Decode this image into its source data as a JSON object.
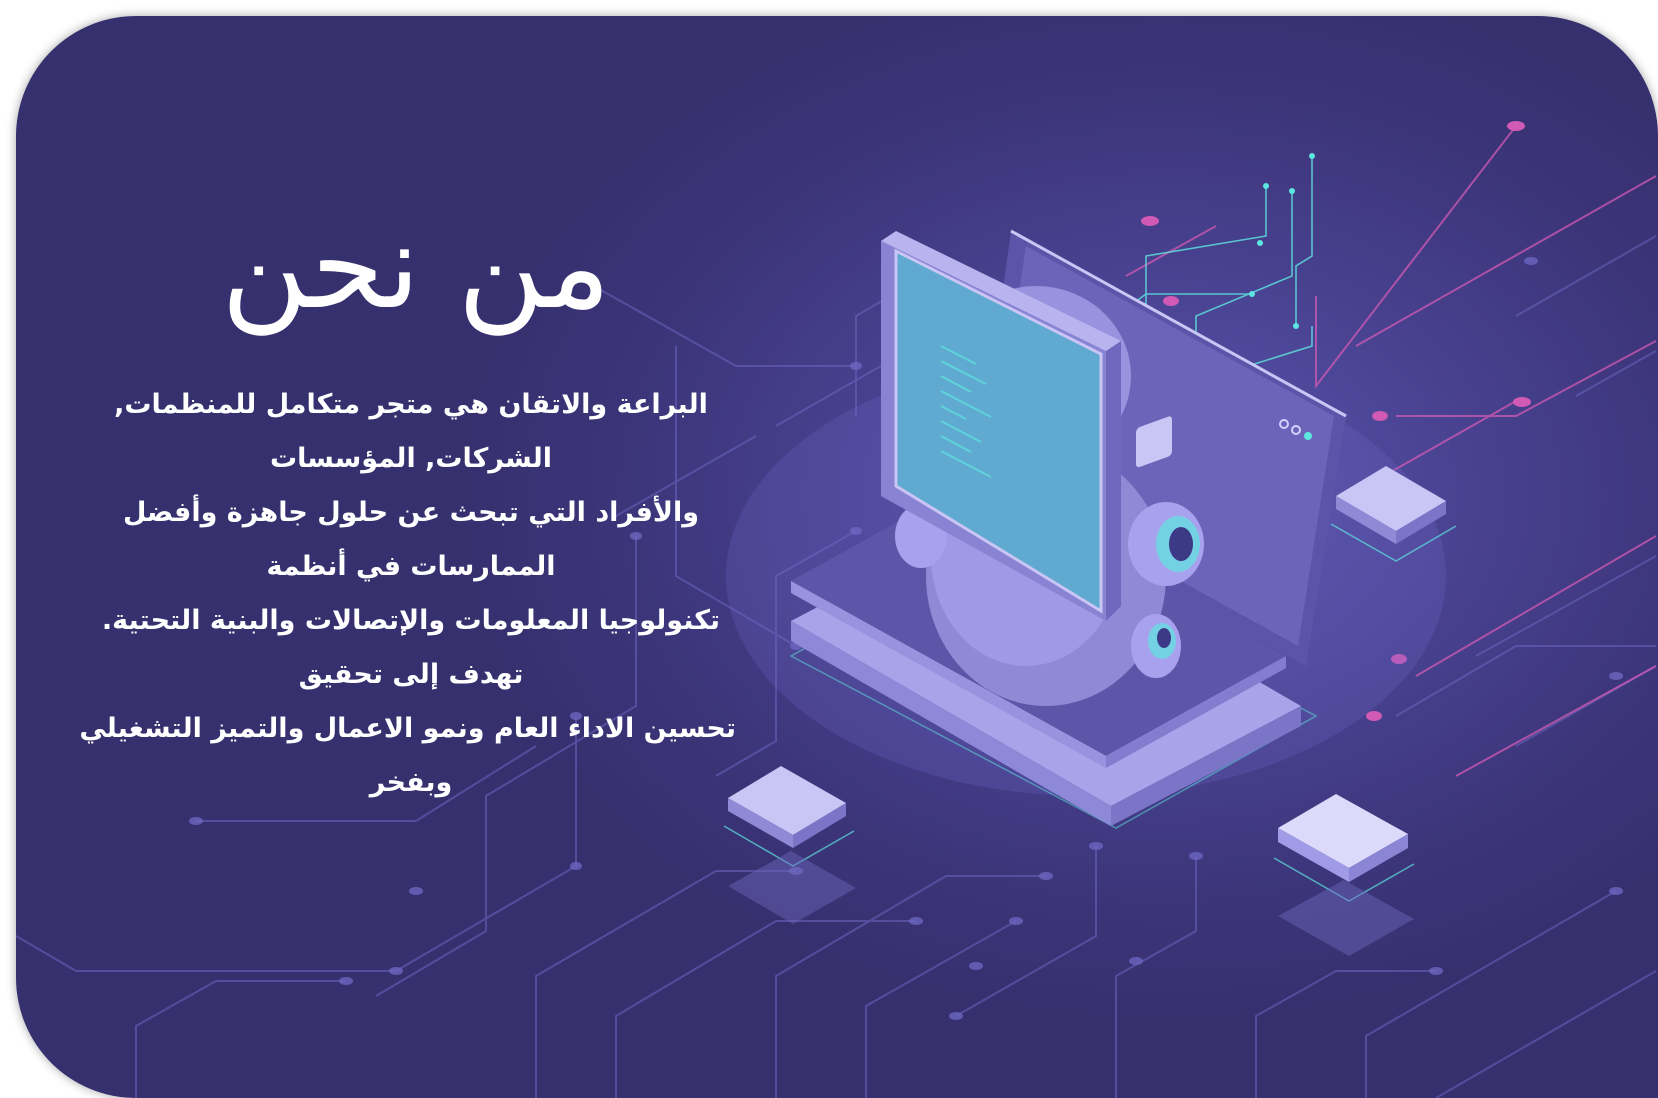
{
  "heading": "من نحن",
  "paragraph_lines": [
    "البراعة والاتقان هي متجر متكامل للمنظمات,",
    "الشركات, المؤسسات",
    "والأفراد التي تبحث عن حلول جاهزة وأفضل",
    "الممارسات في أنظمة",
    "تكنولوجيا المعلومات والإتصالات والبنية التحتية.",
    "تهدف إلى تحقيق",
    "تحسين الاداء العام ونمو الاعمال والتميز التشغيلي",
    "وبفخر"
  ],
  "colors": {
    "background": "#3b3478",
    "circuit_line": "#6c66c0",
    "accent_pink": "#d05ab4",
    "accent_cyan": "#5ee6e0",
    "device_light": "#b9b4f0",
    "text": "#ffffff"
  },
  "illustration": "laptop-robot-circuit-illustration"
}
